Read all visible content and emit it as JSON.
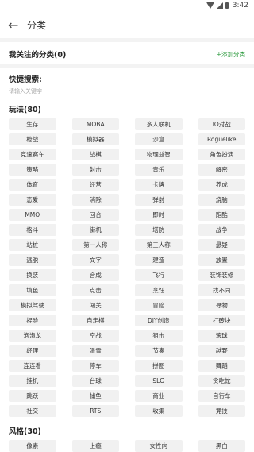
{
  "status": {
    "time": "3:42"
  },
  "header": {
    "title": "分类"
  },
  "followed": {
    "title": "我关注的分类(0)",
    "add_label": "+添加分类"
  },
  "quick_search": {
    "title": "快捷搜索:",
    "placeholder": "请输入关键字"
  },
  "gameplay": {
    "title": "玩法(80)",
    "tags": [
      "生存",
      "MOBA",
      "多人联机",
      "IO对战",
      "枪战",
      "模拟器",
      "沙盒",
      "Roguelike",
      "竞速赛车",
      "战棋",
      "物理益智",
      "角色扮演",
      "策略",
      "射击",
      "音乐",
      "解密",
      "体育",
      "经营",
      "卡牌",
      "养成",
      "恋爱",
      "消除",
      "弹射",
      "烧脑",
      "MMO",
      "回合",
      "即时",
      "跑酷",
      "格斗",
      "街机",
      "塔防",
      "战争",
      "站桩",
      "第一人称",
      "第三人称",
      "悬疑",
      "逃脱",
      "文字",
      "建造",
      "放置",
      "换装",
      "合成",
      "飞行",
      "装饰装修",
      "填色",
      "点击",
      "烹饪",
      "找不同",
      "模拟驾驶",
      "闯关",
      "冒险",
      "寻物",
      "捏脸",
      "自走棋",
      "DIY创造",
      "打砖块",
      "泡泡龙",
      "空战",
      "狙击",
      "滚球",
      "经理",
      "滑雪",
      "节奏",
      "越野",
      "连连看",
      "停车",
      "拼图",
      "舞蹈",
      "挂机",
      "台球",
      "SLG",
      "贪吃蛇",
      "跳跃",
      "捕鱼",
      "商业",
      "自行车",
      "社交",
      "RTS",
      "收集",
      "竞技"
    ]
  },
  "style": {
    "title": "风格(30)",
    "tags": [
      "像素",
      "上瘾",
      "女性向",
      "黑白"
    ]
  }
}
